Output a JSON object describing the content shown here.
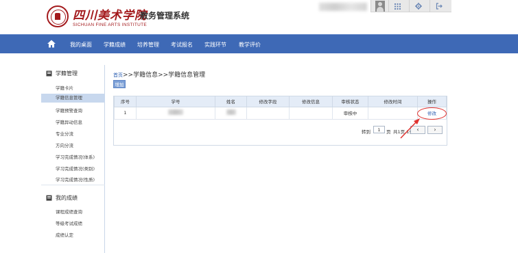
{
  "header": {
    "logo_cn": "四川美术学院",
    "logo_en": "SICHUAN FINE ARTS INSTITUTE",
    "system_title": "教务管理系统",
    "icons": [
      "avatar",
      "grid-icon",
      "gear-icon",
      "logout-icon"
    ]
  },
  "nav": {
    "home_icon": "home-icon",
    "items": [
      "我的桌面",
      "学籍成绩",
      "培养管理",
      "考试报名",
      "实践环节",
      "教学评价"
    ]
  },
  "sidebar": {
    "group1": {
      "icon": "book-icon",
      "title": "学籍管理",
      "items": [
        "学籍卡片",
        "学籍信息管理",
        "学籍预警查询",
        "学籍异动信息",
        "专业分流",
        "方向分流",
        "学习完成情况(体系)",
        "学习完成情况(类别)",
        "学习完成情况(性质)"
      ],
      "active_index": 1
    },
    "group2": {
      "icon": "book-icon",
      "title": "我的成绩",
      "items": [
        "课程成绩查询",
        "等级考试成绩",
        "成绩认定"
      ]
    }
  },
  "main": {
    "breadcrumb_home": "首页",
    "breadcrumb_rest": ">>学籍信息>>学籍信息管理",
    "add_label": "增加",
    "table": {
      "headers": [
        "序号",
        "学号",
        "姓名",
        "修改字段",
        "修改信息",
        "审核状态",
        "修改时间",
        "操作"
      ],
      "rows": [
        {
          "index": "1",
          "status": "审核中",
          "action": "修改"
        }
      ]
    },
    "pager": {
      "goto_label": "转到",
      "page_value": "1",
      "page_label": "页",
      "info": "共1页 1条",
      "prev": "‹",
      "next": "›"
    }
  },
  "colors": {
    "brand_red": "#a3191c",
    "nav_blue": "#3e69b6",
    "annotation_red": "#e0322f"
  }
}
